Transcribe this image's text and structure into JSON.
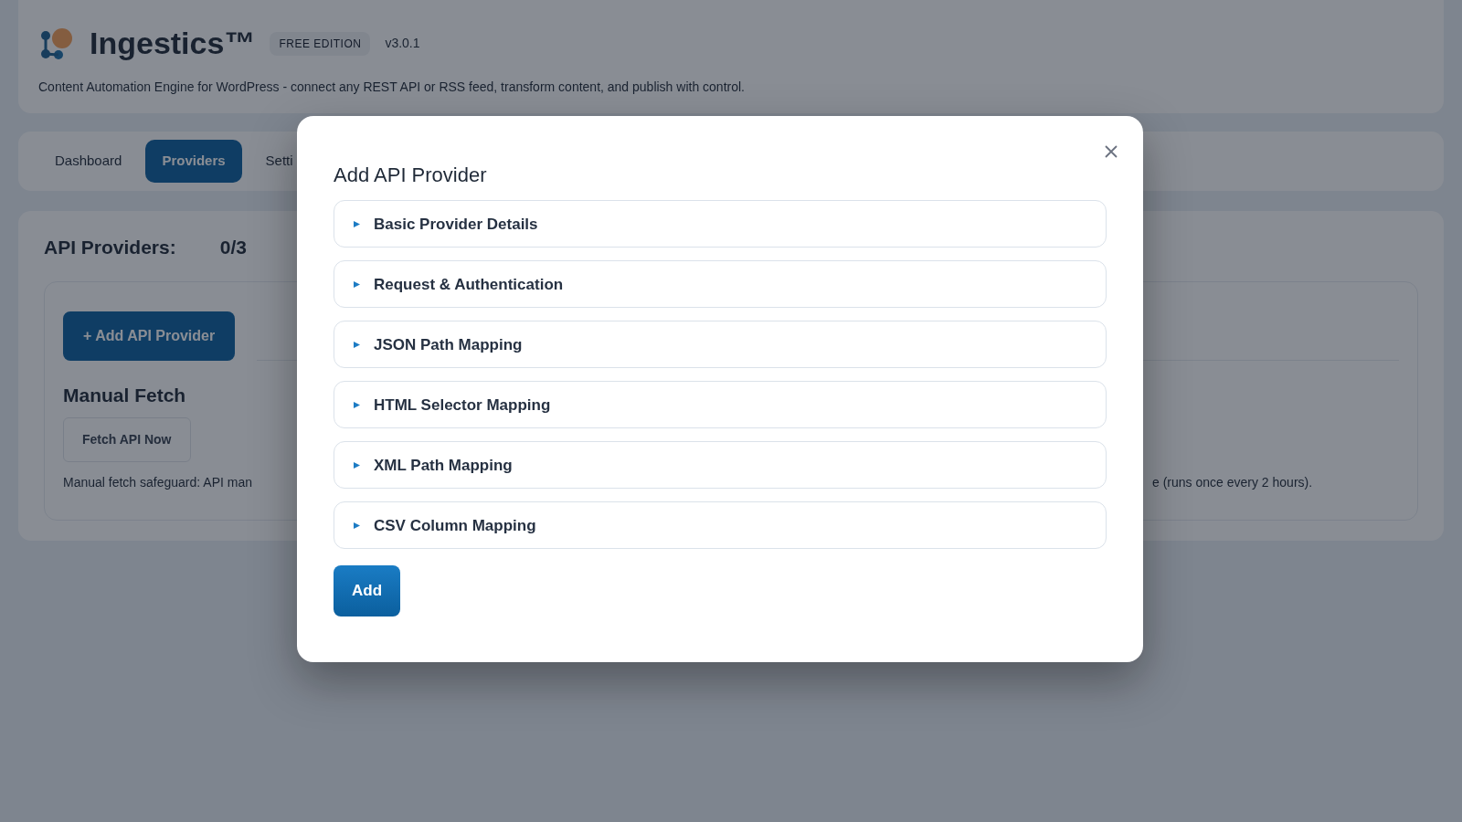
{
  "app": {
    "name": "Ingestics™",
    "edition": "FREE EDITION",
    "version": "v3.0.1",
    "tagline": "Content Automation Engine for WordPress - connect any REST API or RSS feed, transform content, and publish with control."
  },
  "tabs": [
    {
      "label": "Dashboard",
      "selected": false
    },
    {
      "label": "Providers",
      "selected": true
    },
    {
      "label": "Setti",
      "selected": false
    }
  ],
  "providers_panel": {
    "heading": "API Providers:",
    "count": "0/3",
    "add_button": "+ Add API Provider",
    "manual_fetch": {
      "heading": "Manual Fetch",
      "button": "Fetch API Now",
      "note_left": "Manual fetch safeguard: API man",
      "note_right": "e (runs once every 2 hours)."
    }
  },
  "modal": {
    "title": "Add API Provider",
    "sections": [
      {
        "label": "Basic Provider Details",
        "expanded": false
      },
      {
        "label": "Request & Authentication",
        "expanded": false
      },
      {
        "label": "JSON Path Mapping",
        "expanded": false
      },
      {
        "label": "HTML Selector Mapping",
        "expanded": false
      },
      {
        "label": "XML Path Mapping",
        "expanded": false
      },
      {
        "label": "CSV Column Mapping",
        "expanded": false
      }
    ],
    "submit_button": "Add"
  }
}
